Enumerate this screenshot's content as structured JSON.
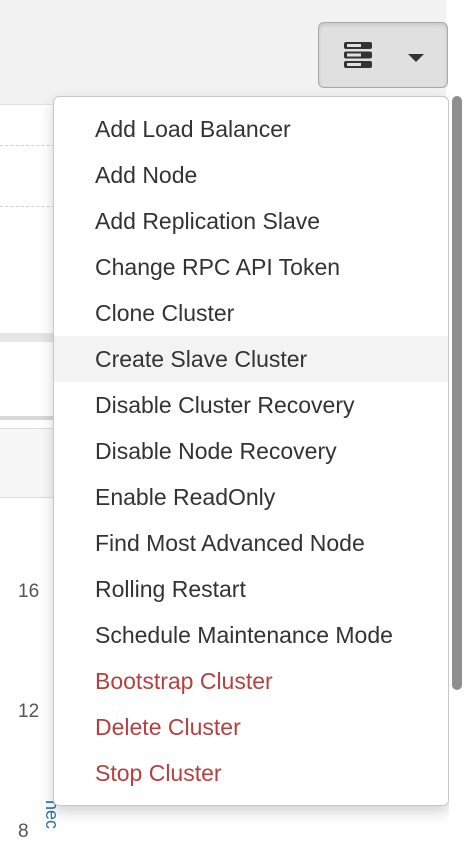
{
  "toolbar": {
    "menu_toggle_icon": "server-stack-icon",
    "caret_icon": "caret-down-icon"
  },
  "menu": {
    "items": [
      {
        "label": "Add Load Balancer",
        "style": "normal"
      },
      {
        "label": "Add Node",
        "style": "normal"
      },
      {
        "label": "Add Replication Slave",
        "style": "normal"
      },
      {
        "label": "Change RPC API Token",
        "style": "normal"
      },
      {
        "label": "Clone Cluster",
        "style": "normal"
      },
      {
        "label": "Create Slave Cluster",
        "style": "hovered"
      },
      {
        "label": "Disable Cluster Recovery",
        "style": "normal"
      },
      {
        "label": "Disable Node Recovery",
        "style": "normal"
      },
      {
        "label": "Enable ReadOnly",
        "style": "normal"
      },
      {
        "label": "Find Most Advanced Node",
        "style": "normal"
      },
      {
        "label": "Rolling Restart",
        "style": "normal"
      },
      {
        "label": "Schedule Maintenance Mode",
        "style": "normal"
      },
      {
        "label": "Bootstrap Cluster",
        "style": "danger"
      },
      {
        "label": "Delete Cluster",
        "style": "danger"
      },
      {
        "label": "Stop Cluster",
        "style": "danger"
      }
    ]
  },
  "background": {
    "axis_labels": [
      "16",
      "12",
      "8"
    ],
    "vertical_link_text": "nec"
  },
  "colors": {
    "menu_text": "#333333",
    "danger_text": "#b5403f",
    "hover_background": "#f3f3f3",
    "toolbar_background": "#f2f2f2",
    "link": "#2a6db8"
  }
}
